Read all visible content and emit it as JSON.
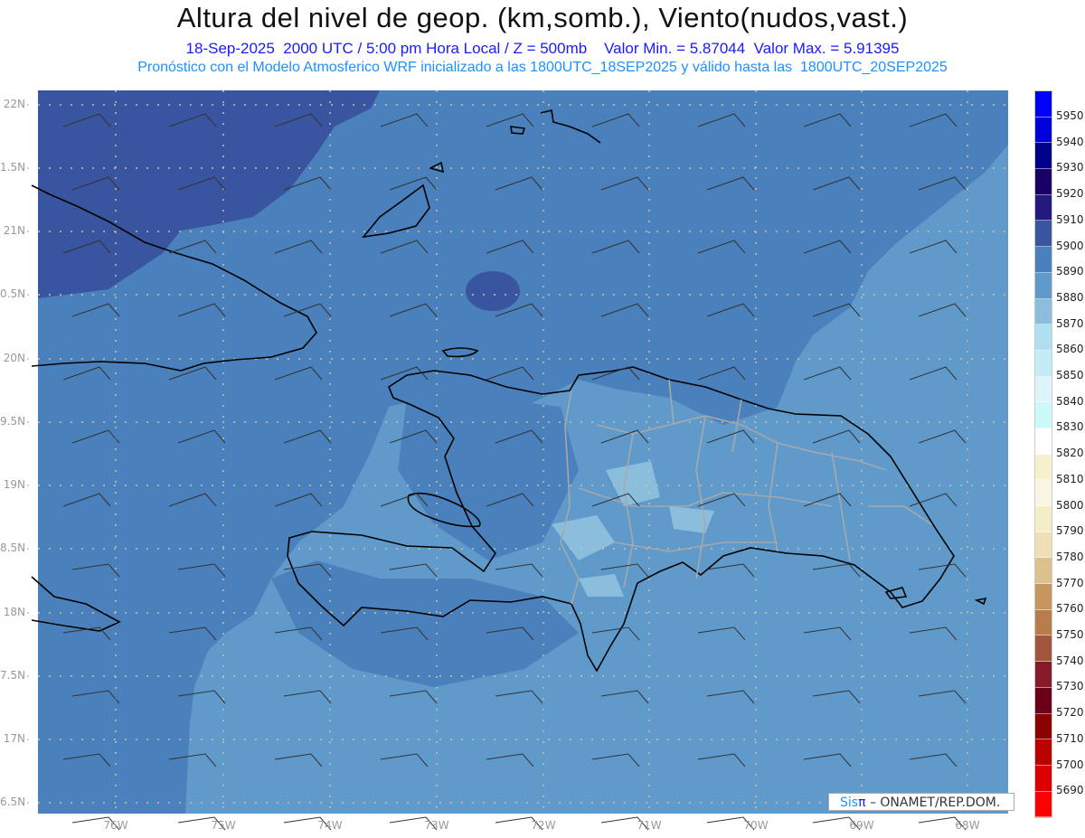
{
  "header": {
    "title": "Altura del nivel de geop. (km,somb.), Viento(nudos,vast.)",
    "subtitle": "18-Sep-2025  2000 UTC / 5:00 pm Hora Local / Z = 500mb    Valor Min. = 5.87044  Valor Max. = 5.91395",
    "model_line": "Pronóstico con el Modelo Atmosferico WRF inicializado a las 1800UTC_18SEP2025 y válido hasta las  1800UTC_20SEP2025"
  },
  "axes": {
    "lat_labels": [
      "22N",
      "1.5N",
      "21N",
      "0.5N",
      "20N",
      "9.5N",
      "19N",
      "8.5N",
      "18N",
      "7.5N",
      "17N",
      "6.5N"
    ],
    "lon_labels": [
      "76W",
      "75W",
      "74W",
      "73W",
      "72W",
      "71W",
      "70W",
      "69W",
      "68W"
    ]
  },
  "colorbar": {
    "labels": [
      "5950",
      "5940",
      "5930",
      "5920",
      "5910",
      "5900",
      "5890",
      "5880",
      "5870",
      "5860",
      "5850",
      "5840",
      "5830",
      "5820",
      "5810",
      "5800",
      "5790",
      "5780",
      "5770",
      "5760",
      "5750",
      "5740",
      "5730",
      "5720",
      "5710",
      "5700",
      "5690"
    ],
    "colors": [
      "#0000ff",
      "#0000dd",
      "#00008b",
      "#1a0066",
      "#231a80",
      "#3a55a0",
      "#4a80bb",
      "#5f9acb",
      "#8bbedd",
      "#b0dff0",
      "#c4ecf5",
      "#ddf5fa",
      "#ccfafa",
      "#ffffff",
      "#f7f0cc",
      "#fbf5e3",
      "#f5ecc8",
      "#eedfb5",
      "#dcc08e",
      "#c6965e",
      "#b87d4c",
      "#a2573d",
      "#861a28",
      "#6b0018",
      "#8b0000",
      "#bb0000",
      "#dd0000",
      "#ff0000"
    ]
  },
  "map_colors": {
    "dark": "#3a55a0",
    "main": "#4a80bb",
    "light": "#5f9acb",
    "lighter": "#8bbedd",
    "coast": "#000000",
    "border": "#a8a8a8"
  },
  "credit": {
    "sis": "Sis",
    "pi": "π",
    "org": " –  ONAMET/REP.DOM."
  }
}
